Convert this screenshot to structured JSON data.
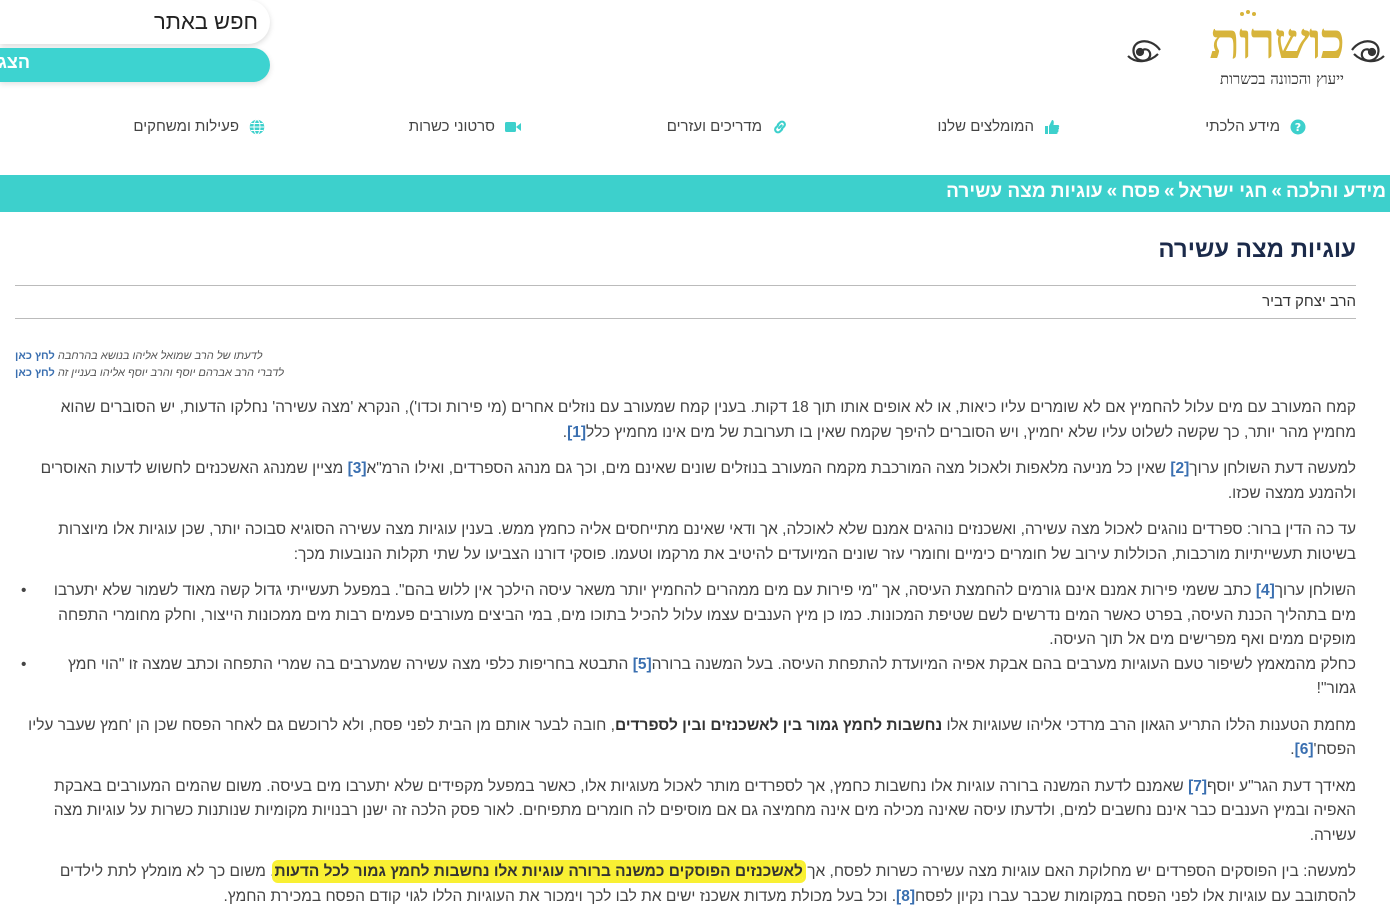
{
  "logo": {
    "title": "כושרות",
    "tagline": "ייעוץ והכוונה בכשרות"
  },
  "search": {
    "placeholder": "חפש באתר",
    "button_label": "הצג"
  },
  "nav": {
    "items": [
      {
        "label": "מידע הלכתי",
        "icon": "question-circle-icon"
      },
      {
        "label": "המומלצים שלנו",
        "icon": "thumbs-up-icon"
      },
      {
        "label": "מדריכים ועזרים",
        "icon": "link-icon"
      },
      {
        "label": "סרטוני כשרות",
        "icon": "video-camera-icon"
      },
      {
        "label": "פעילות ומשחקים",
        "icon": "globe-icon"
      }
    ]
  },
  "breadcrumb": {
    "items": [
      "מידע והלכה",
      "חגי ישראל",
      "פסח",
      "עוגיות מצה עשירה"
    ],
    "separator": "»"
  },
  "article": {
    "title": "עוגיות מצה עשירה",
    "author": "הרב יצחק דביר",
    "notes": [
      {
        "text": "לדעתו של הרב שמואל אליהו בנושא בהרחבה",
        "link": "לחץ כאן"
      },
      {
        "text": "לדברי הרב אברהם יוסף והרב יוסף אליהו בעניין זה",
        "link": "לחץ כאן"
      }
    ],
    "p1": {
      "text": "קמח המעורב עם מים עלול להחמיץ אם לא שומרים עליו כיאות, או לא אופים אותו תוך 18 דקות. בענין קמח שמעורב עם נוזלים אחרים (מי פירות וכדו'), הנקרא 'מצה עשירה' נחלקו הדעות, יש הסוברים שהוא מחמיץ מהר יותר, כך שקשה לשלוט עליו שלא יחמיץ, ויש הסוברים להיפך שקמח שאין בו תערובת של מים אינו מחמיץ כלל",
      "ref": "[1]",
      "end": "."
    },
    "p2": {
      "a": "למעשה דעת השולחן ערוך",
      "ref1": "[2]",
      "b": " שאין כל מניעה מלאפות ולאכול מצה המורכבת מקמח המעורב בנוזלים שונים שאינם מים, וכך גם מנהג הספרדים, ואילו הרמ\"א",
      "ref2": "[3]",
      "c": " מציין שמנהג האשכנזים לחשוש לדעות האוסרים ולהמנע ממצה שכזו."
    },
    "p3": "עד כה הדין ברור: ספרדים נוהגים לאכול מצה עשירה, ואשכנזים נוהגים אמנם שלא לאוכלה, אך ודאי שאינם מתייחסים אליה כחמץ ממש. בענין עוגיות מצה עשירה הסוגיא סבוכה יותר, שכן עוגיות אלו מיוצרות בשיטות תעשייתיות מורכבות, הכוללות עירוב של חומרים כימיים וחומרי עזר שונים המיועדים להיטיב את מרקמו וטעמו. פוסקי דורנו הצביעו על שתי תקלות הנובעות מכך:",
    "bullet1": {
      "a": "השולחן ערוך",
      "ref": "[4]",
      "b": " כתב ששמי פירות אמנם אינם גורמים להחמצת העיסה, אך \"מי פירות עם מים ממהרים להחמיץ יותר משאר עיסה הילכך אין ללוש בהם\". במפעל תעשייתי גדול קשה מאוד לשמור שלא יתערבו מים בתהליך הכנת העיסה, בפרט כאשר המים נדרשים לשם שטיפת המכונות. כמו כן מיץ הענבים עצמו עלול להכיל בתוכו מים, במי הביצים מעורבים פעמים רבות מים ממכונות הייצור, וחלק מחומרי התפחה מופקים ממים ואף מפרישים מים אל תוך העיסה."
    },
    "bullet2": {
      "a": "כחלק מהמאמץ לשיפור טעם העוגיות מערבים בהם אבקת אפיה המיועדת להתפחת העיסה. בעל המשנה ברורה",
      "ref": "[5]",
      "b": " התבטא בחריפות כלפי מצה עשירה שמערבים בה שמרי התפחה וכתב שמצה זו \"הוי חמץ גמור\"!"
    },
    "p4": {
      "a": "מחמת הטענות הללו התריע הגאון הרב מרדכי אליהו שעוגיות אלו ",
      "strong": "נחשבות לחמץ גמור בין לאשכנזים ובין לספרדים",
      "b": ", חובה לבער אותם מן הבית לפני פסח, ולא לרוכשם גם לאחר הפסח שכן הן 'חמץ שעבר עליו הפסח'",
      "ref": "[6]",
      "end": "."
    },
    "p5": {
      "a": "מאידך דעת הגר\"ע יוסף",
      "ref": "[7]",
      "b": " שאמנם לדעת המשנה ברורה עוגיות אלו נחשבות כחמץ, אך לספרדים מותר לאכול מעוגיות אלו, כאשר במפעל מקפידים שלא יתערבו מים בעיסה. משום שהמים המעורבים באבקת האפיה ובמיץ הענבים כבר אינם נחשבים למים, ולדעתו עיסה שאינה מכילה מים אינה מחמיצה גם אם מוסיפים לה חומרים מתפיחים. לאור פסק הלכה זה ישנן רבנויות מקומיות שנותנות כשרות על עוגיות מצה עשירה."
    },
    "p6": {
      "a": "למעשה: בין הפוסקים הספרדים יש מחלוקת האם עוגיות מצה עשירה כשרות לפסח, אך ",
      "highlight": "לאשכנזים הפוסקים כמשנה ברורה עוגיות אלו נחשבות לחמץ גמור לכל הדעות",
      "b": ". משום כך לא מומלץ לתת לילדים להסתובב עם עוגיות אלו לפני הפסח במקומות שכבר עברו נקיון לפסח",
      "ref": "[8]",
      "c": ". וכל בעל מכולת מעדות אשכנז ישים את לבו לכך וימכור את העוגיות הללו לגוי קודם הפסח במכירת החמץ."
    }
  },
  "colors": {
    "accent": "#3dd0cc",
    "logo_gold": "#d7b43b",
    "highlight": "#f9f033",
    "title": "#1b2a4a",
    "link": "#3a6fb0"
  }
}
